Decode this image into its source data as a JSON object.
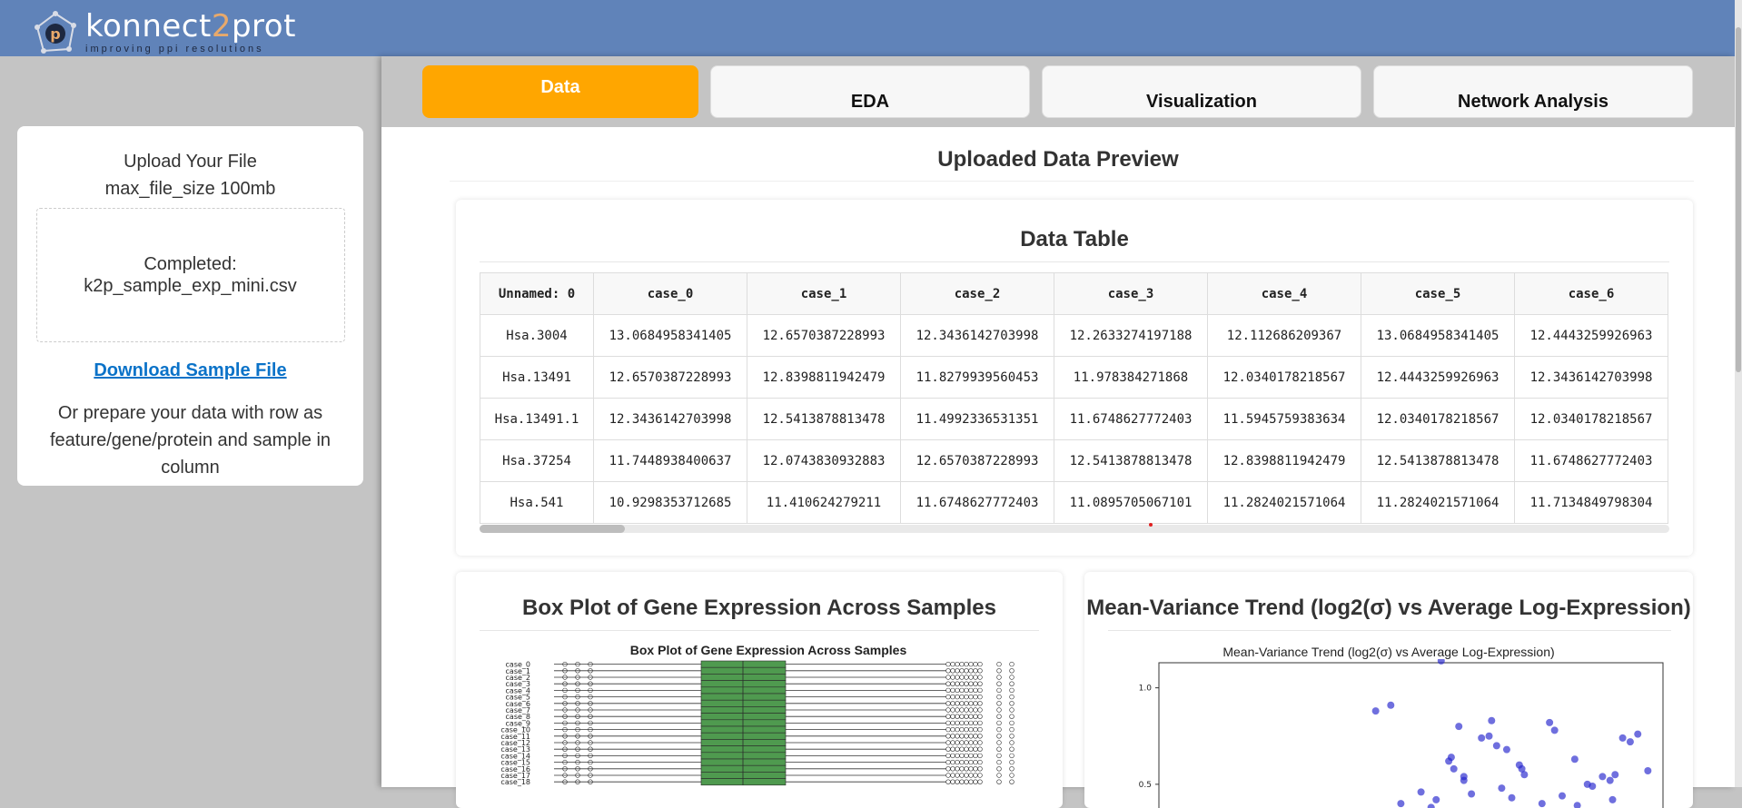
{
  "brand": {
    "name_part1": "konnect",
    "name_part2": "2",
    "name_part3": "prot",
    "tagline": "improving ppi resolutions",
    "header_color": "#6083b9"
  },
  "sidebar": {
    "upload_title": "Upload Your File",
    "max_size": "max_file_size 100mb",
    "status_label": "Completed:",
    "file_name": "k2p_sample_exp_mini.csv",
    "download_label": "Download Sample File",
    "instructions": "Or prepare your data with row as feature/gene/protein and sample in column"
  },
  "tabs": [
    {
      "label": "Data",
      "active": true
    },
    {
      "label": "EDA",
      "active": false
    },
    {
      "label": "Visualization",
      "active": false
    },
    {
      "label": "Network Analysis",
      "active": false
    }
  ],
  "accent_color": "#ffa600",
  "preview_title": "Uploaded Data Preview",
  "data_table": {
    "title": "Data Table",
    "columns": [
      "Unnamed: 0",
      "case_0",
      "case_1",
      "case_2",
      "case_3",
      "case_4",
      "case_5",
      "case_6"
    ],
    "rows": [
      [
        "Hsa.3004",
        "13.0684958341405",
        "12.6570387228993",
        "12.3436142703998",
        "12.2633274197188",
        "12.112686209367",
        "13.0684958341405",
        "12.4443259926963"
      ],
      [
        "Hsa.13491",
        "12.6570387228993",
        "12.8398811942479",
        "11.8279939560453",
        "11.978384271868",
        "12.0340178218567",
        "12.4443259926963",
        "12.3436142703998"
      ],
      [
        "Hsa.13491.1",
        "12.3436142703998",
        "12.5413878813478",
        "11.4992336531351",
        "11.6748627772403",
        "11.5945759383634",
        "12.0340178218567",
        "12.0340178218567"
      ],
      [
        "Hsa.37254",
        "11.7448938400637",
        "12.0743830932883",
        "12.6570387228993",
        "12.5413878813478",
        "12.8398811942479",
        "12.5413878813478",
        "11.6748627772403"
      ],
      [
        "Hsa.541",
        "10.9298353712685",
        "11.410624279211",
        "11.6748627772403",
        "11.0895705067101",
        "11.2824021571064",
        "11.2824021571064",
        "11.7134849798304"
      ]
    ]
  },
  "box_plot": {
    "card_title": "Box Plot of Gene Expression Across Samples",
    "plot_title": "Box Plot of Gene Expression Across Samples",
    "labels": [
      "case_0",
      "case_1",
      "case_2",
      "case_3",
      "case_4",
      "case_5",
      "case_6",
      "case_7",
      "case_8",
      "case_9",
      "case_10",
      "case_11",
      "case_12",
      "case_13",
      "case_14",
      "case_15",
      "case_16",
      "case_17",
      "case_18"
    ],
    "box_color": "#4f9a4f"
  },
  "mean_variance": {
    "card_title": "Mean-Variance Trend (log2(σ) vs Average Log-Expression)",
    "plot_title": "Mean-Variance Trend (log2(σ) vs Average Log-Expression)",
    "y_ticks": [
      "1.0",
      "0.5"
    ],
    "point_color": "#2222cc"
  },
  "chart_data": [
    {
      "type": "scatter",
      "title": "Mean-Variance Trend (log2(σ) vs Average Log-Expression)",
      "xlabel": "",
      "ylabel": "",
      "ylim": [
        0.33,
        1.13
      ],
      "xlim": [
        0,
        10
      ],
      "points": [
        [
          4.3,
          0.88
        ],
        [
          4.6,
          0.91
        ],
        [
          5.6,
          1.14
        ],
        [
          5.8,
          0.64
        ],
        [
          5.75,
          0.62
        ],
        [
          5.85,
          0.58
        ],
        [
          5.95,
          0.8
        ],
        [
          6.05,
          0.52
        ],
        [
          6.05,
          0.54
        ],
        [
          6.4,
          0.74
        ],
        [
          6.55,
          0.75
        ],
        [
          6.6,
          0.83
        ],
        [
          6.7,
          0.7
        ],
        [
          6.9,
          0.68
        ],
        [
          7.15,
          0.6
        ],
        [
          7.2,
          0.58
        ],
        [
          7.25,
          0.55
        ],
        [
          7.75,
          0.82
        ],
        [
          7.85,
          0.78
        ],
        [
          8.25,
          0.63
        ],
        [
          8.5,
          0.5
        ],
        [
          8.6,
          0.49
        ],
        [
          8.8,
          0.54
        ],
        [
          8.95,
          0.52
        ],
        [
          9.05,
          0.55
        ],
        [
          9.2,
          0.74
        ],
        [
          9.35,
          0.72
        ],
        [
          9.5,
          0.76
        ],
        [
          9.7,
          0.57
        ],
        [
          5.2,
          0.46
        ],
        [
          5.5,
          0.42
        ],
        [
          6.2,
          0.45
        ],
        [
          7.0,
          0.43
        ],
        [
          8.0,
          0.44
        ],
        [
          9.0,
          0.42
        ],
        [
          6.8,
          0.48
        ],
        [
          4.8,
          0.4
        ],
        [
          5.4,
          0.38
        ],
        [
          7.6,
          0.4
        ],
        [
          8.3,
          0.39
        ]
      ]
    }
  ]
}
